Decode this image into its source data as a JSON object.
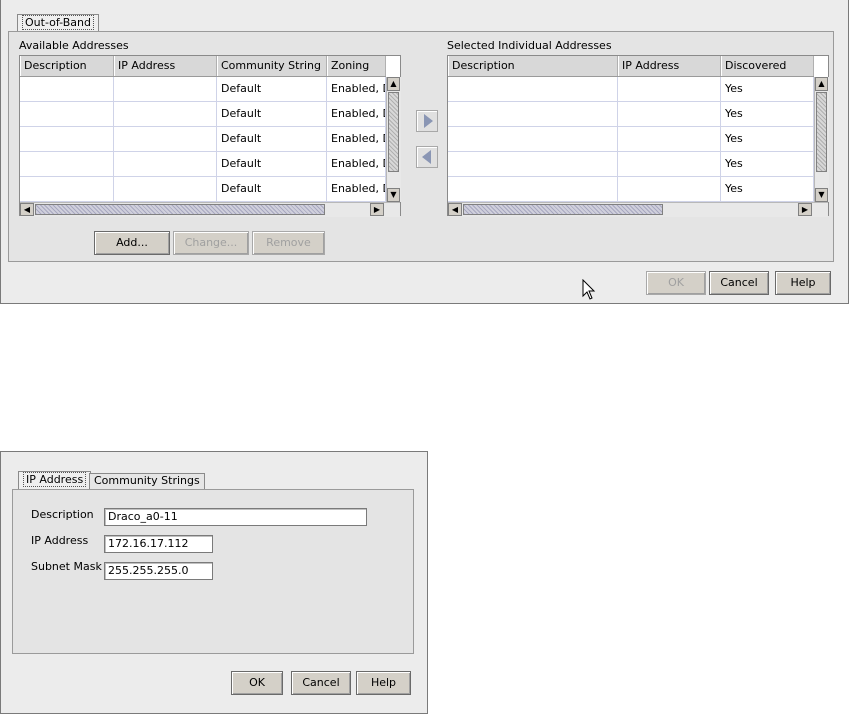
{
  "top_dialog": {
    "tab_label": "Out-of-Band",
    "available": {
      "title": "Available Addresses",
      "columns": [
        "Description",
        "IP Address",
        "Community String",
        "Zoning"
      ],
      "rows": [
        [
          "",
          "",
          "Default",
          "Enabled, D"
        ],
        [
          "",
          "",
          "Default",
          "Enabled, D"
        ],
        [
          "",
          "",
          "Default",
          "Enabled, D"
        ],
        [
          "",
          "",
          "Default",
          "Enabled, D"
        ],
        [
          "",
          "",
          "Default",
          "Enabled, D"
        ]
      ],
      "buttons": {
        "add": "Add...",
        "change": "Change...",
        "remove": "Remove"
      }
    },
    "selected": {
      "title": "Selected Individual Addresses",
      "columns": [
        "Description",
        "IP Address",
        "Discovered"
      ],
      "rows": [
        [
          "",
          "",
          "Yes"
        ],
        [
          "",
          "",
          "Yes"
        ],
        [
          "",
          "",
          "Yes"
        ],
        [
          "",
          "",
          "Yes"
        ],
        [
          "",
          "",
          "Yes"
        ]
      ]
    },
    "buttons": {
      "ok": "OK",
      "cancel": "Cancel",
      "help": "Help"
    }
  },
  "bottom_dialog": {
    "tabs": [
      "IP Address",
      "Community Strings"
    ],
    "fields": {
      "description": {
        "label": "Description",
        "value": "Draco_a0-11"
      },
      "ip_address": {
        "label": "IP Address",
        "value": "172.16.17.112"
      },
      "subnet_mask": {
        "label": "Subnet Mask",
        "value": "255.255.255.0"
      }
    },
    "buttons": {
      "ok": "OK",
      "cancel": "Cancel",
      "help": "Help"
    }
  },
  "icons": {
    "move_right": "right-triangle-icon",
    "move_left": "left-triangle-icon",
    "cursor": "mouse-pointer-icon"
  },
  "colors": {
    "dialog_bg": "#ececec",
    "panel_bg": "#e4e4e4",
    "grid_line": "#cfd3e8"
  }
}
